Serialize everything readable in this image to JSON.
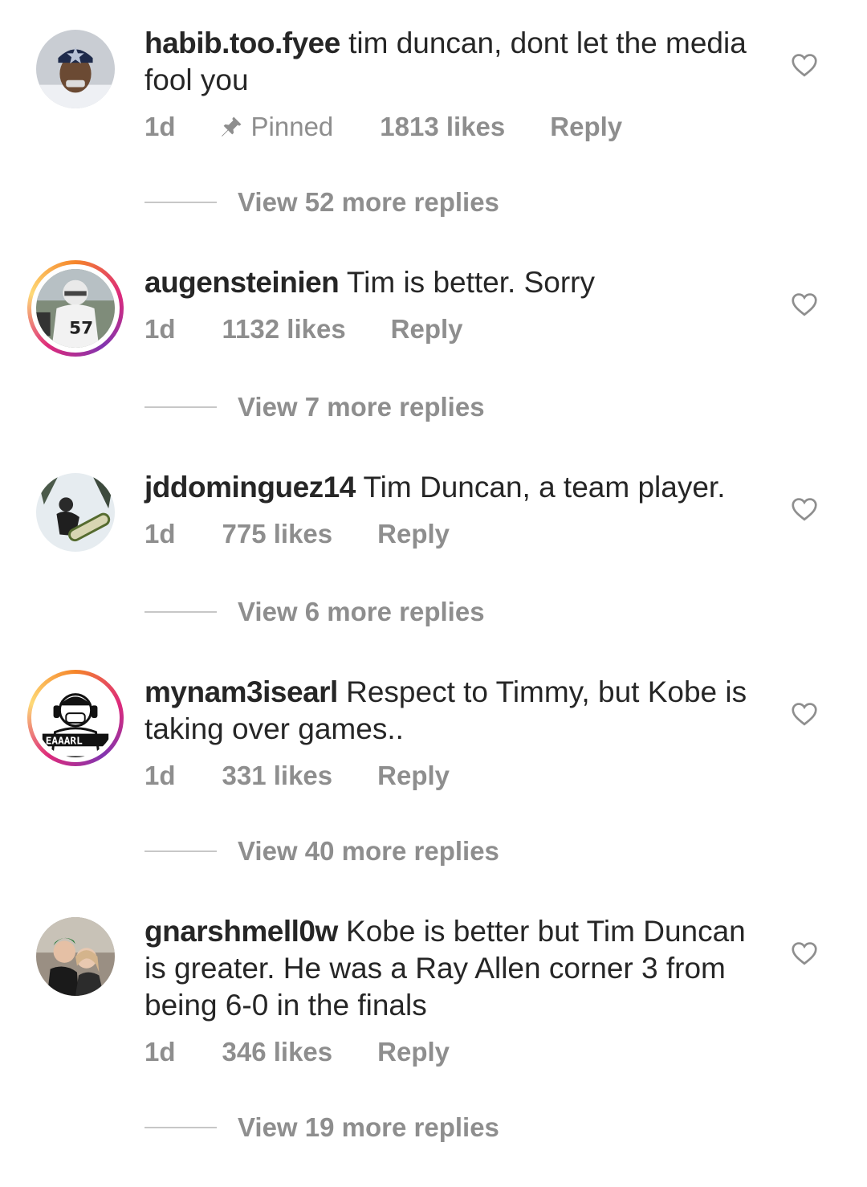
{
  "comments": [
    {
      "username": "habib.too.fyee",
      "text": "tim duncan, dont let the media fool you",
      "age": "1d",
      "pinned_label": "Pinned",
      "likes": "1813 likes",
      "reply_label": "Reply",
      "view_replies": "View 52 more replies",
      "has_story_ring": false
    },
    {
      "username": "augensteinien",
      "text": "Tim is better. Sorry",
      "age": "1d",
      "likes": "1132 likes",
      "reply_label": "Reply",
      "view_replies": "View 7 more replies",
      "has_story_ring": true
    },
    {
      "username": "jddominguez14",
      "text": "Tim Duncan, a team player.",
      "age": "1d",
      "likes": "775 likes",
      "reply_label": "Reply",
      "view_replies": "View 6 more replies",
      "has_story_ring": false
    },
    {
      "username": "mynam3isearl",
      "text": "Respect to Timmy, but Kobe is taking over games..",
      "age": "1d",
      "likes": "331 likes",
      "reply_label": "Reply",
      "view_replies": "View 40 more replies",
      "has_story_ring": true
    },
    {
      "username": "gnarshmell0w",
      "text": "Kobe is better but Tim Duncan is greater. He was a Ray Allen corner 3 from being 6-0 in the finals",
      "age": "1d",
      "likes": "346 likes",
      "reply_label": "Reply",
      "view_replies": "View 19 more replies",
      "has_story_ring": false
    }
  ],
  "icons": {
    "like": "heart-outline-icon",
    "pin": "pin-icon"
  },
  "colors": {
    "primary_text": "#262626",
    "secondary_text": "#8e8e8e",
    "divider": "#c7c7c7"
  }
}
